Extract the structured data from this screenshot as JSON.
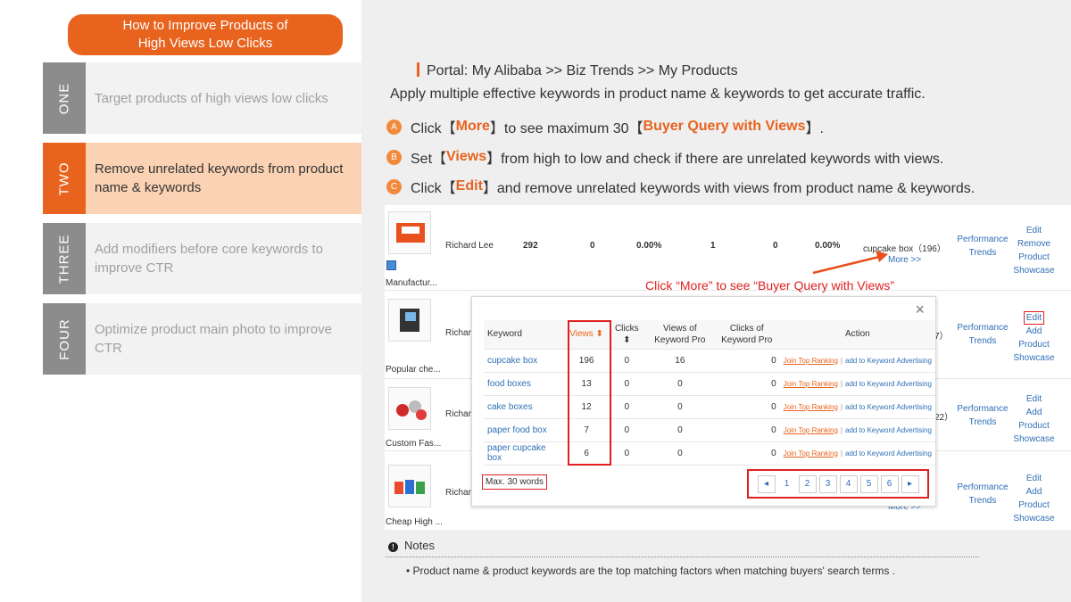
{
  "sidebar": {
    "title": "How to Improve Products of\nHigh Views Low Clicks",
    "steps": [
      {
        "num": "ONE",
        "text": "Target products of high views low clicks"
      },
      {
        "num": "TWO",
        "text": "Remove unrelated keywords from product name & keywords"
      },
      {
        "num": "THREE",
        "text": "Add modifiers before core keywords to improve CTR"
      },
      {
        "num": "FOUR",
        "text": "Optimize product main photo to improve CTR"
      }
    ]
  },
  "main": {
    "portal": "Portal: My Alibaba >> Biz Trends >> My Products",
    "apply": "Apply multiple effective keywords in product name & keywords to get accurate traffic.",
    "instructions": [
      {
        "badge": "A",
        "pre": "Click【",
        "hl": "More",
        "post": "】to see maximum 30【",
        "hl2": "Buyer Query with Views",
        "post2": "】."
      },
      {
        "badge": "B",
        "pre": "Set【",
        "hl": "Views",
        "post": "】from high to low and check if there are unrelated keywords with views.",
        "hl2": "",
        "post2": ""
      },
      {
        "badge": "C",
        "pre": "Click【",
        "hl": "Edit",
        "post": "】and remove unrelated keywords with views from product name & keywords.",
        "hl2": "",
        "post2": ""
      }
    ],
    "products": [
      {
        "name": "Manufactur...",
        "owner": "Richard Lee",
        "exposure": "292",
        "clicks": "0",
        "ctr": "0.00%",
        "col4": "1",
        "col5": "0",
        "col6": "0.00%",
        "query": "cupcake box（196）",
        "more": "More >>"
      },
      {
        "name": "Popular che...",
        "owner": "Richar",
        "query_tail": "7）"
      },
      {
        "name": "Custom Fas...",
        "owner": "Richar",
        "query_tail": "22）"
      },
      {
        "name": "Cheap High ...",
        "owner": "Richar",
        "more_tail": "More >>"
      }
    ],
    "perf_label": [
      "Performance",
      "Trends"
    ],
    "actions_row1": [
      "Edit",
      "Remove",
      "Product",
      "Showcase"
    ],
    "actions_other": [
      "Edit",
      "Add",
      "Product",
      "Showcase"
    ],
    "annotation": "Click “More” to see “Buyer Query with Views”",
    "popup": {
      "close": "×",
      "headers": [
        "Keyword",
        "Views ⬍",
        "Clicks ⬍",
        "Views of\nKeyword Pro",
        "Clicks of\nKeyword Pro",
        "Action"
      ],
      "rows": [
        {
          "kw": "cupcake box",
          "views": "196",
          "clicks": "0",
          "vkp": "16",
          "ckp": "0"
        },
        {
          "kw": "food boxes",
          "views": "13",
          "clicks": "0",
          "vkp": "0",
          "ckp": "0"
        },
        {
          "kw": "cake boxes",
          "views": "12",
          "clicks": "0",
          "vkp": "0",
          "ckp": "0"
        },
        {
          "kw": "paper food box",
          "views": "7",
          "clicks": "0",
          "vkp": "0",
          "ckp": "0"
        },
        {
          "kw": "paper cupcake box",
          "views": "6",
          "clicks": "0",
          "vkp": "0",
          "ckp": "0"
        }
      ],
      "action_join": "Join Top Ranking",
      "action_sep": "|",
      "action_add": "add to Keyword Advertising",
      "max_words": "Max. 30 words",
      "pages": [
        "◂",
        "1",
        "2",
        "3",
        "4",
        "5",
        "6",
        "▸"
      ]
    },
    "notes_title": "Notes",
    "note_item": "Product name & product keywords are the top matching factors when matching buyers' search terms ."
  },
  "colors": {
    "accent": "#e8631e",
    "link": "#2f6fb6",
    "highlight": "#e02020"
  }
}
